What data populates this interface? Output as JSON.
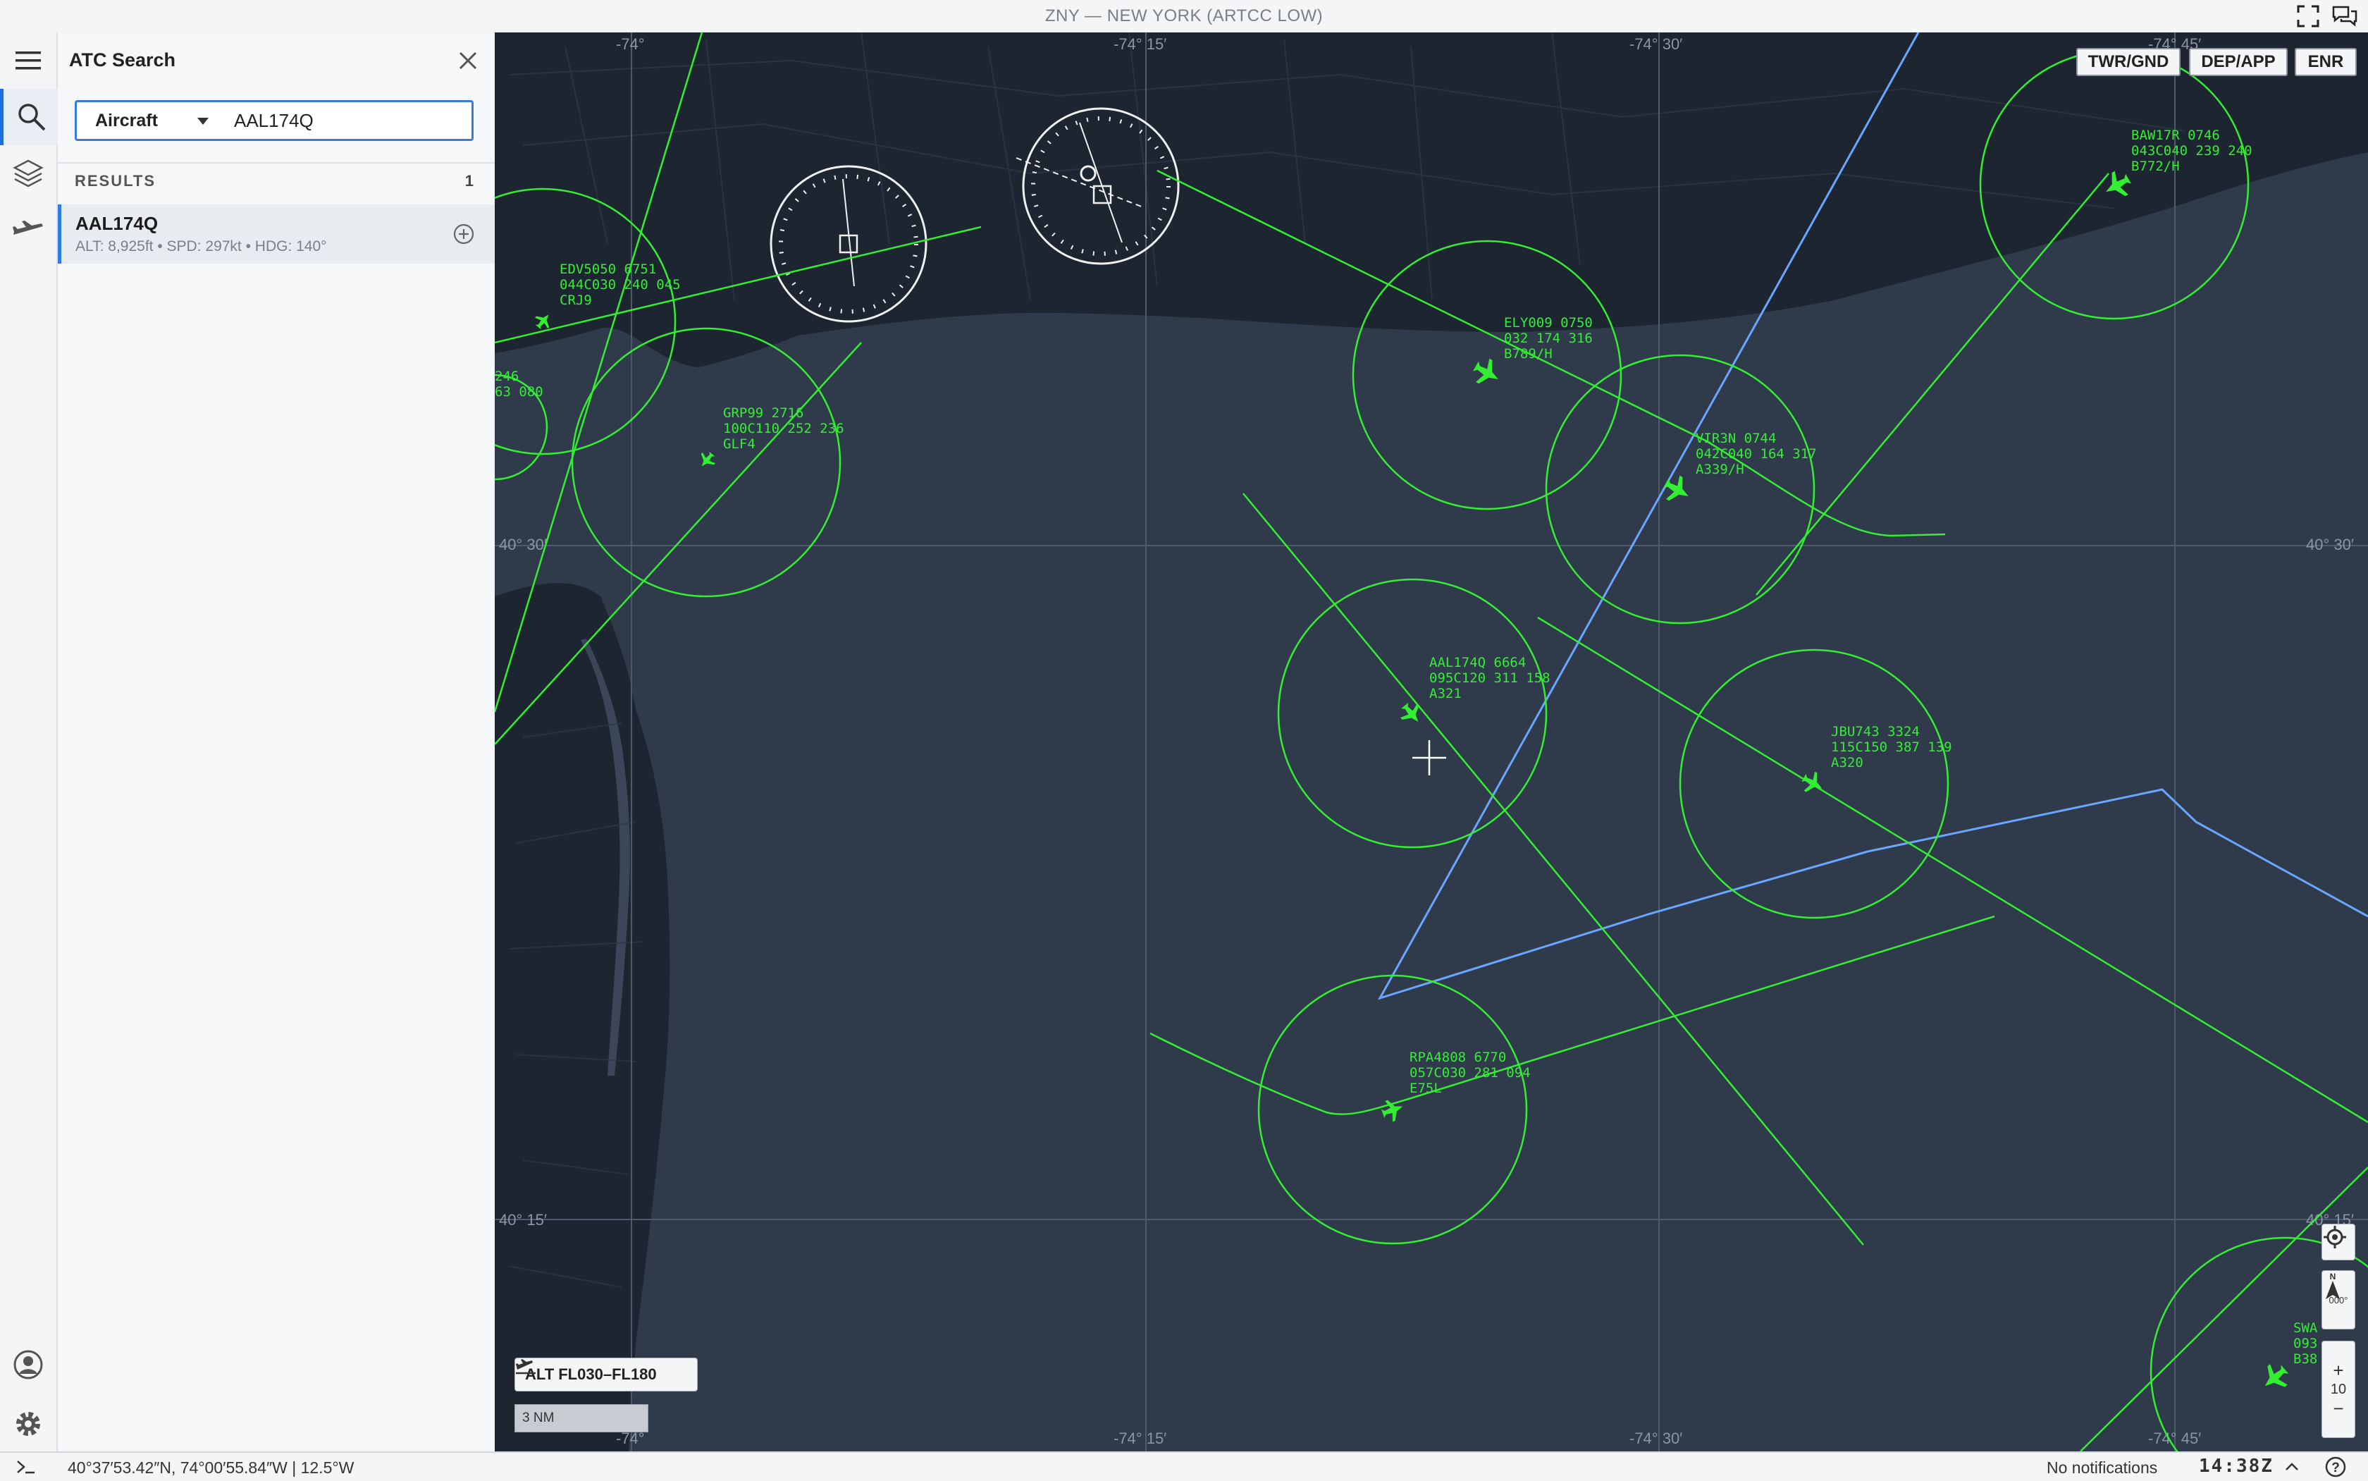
{
  "window": {
    "title": "ZNY — NEW YORK (ARTCC LOW)"
  },
  "panel": {
    "title": "ATC Search",
    "search": {
      "category": "Aircraft",
      "value": "AAL174Q",
      "placeholder": ""
    },
    "results_label": "RESULTS",
    "results_count": "1",
    "results": [
      {
        "callsign": "AAL174Q",
        "details": "ALT: 8,925ft • SPD: 297kt • HDG: 140°"
      }
    ]
  },
  "scope_buttons": {
    "twr_gnd": "TWR/GND",
    "dep_app": "DEP/APP",
    "enr": "ENR"
  },
  "map": {
    "grid_labels": {
      "top": [
        "-74°",
        "-74° 15′",
        "-74° 30′",
        "-74° 45′"
      ],
      "bottom": [
        "-74°",
        "-74° 15′",
        "-74° 30′",
        "-74° 45′"
      ],
      "left": [
        "40° 30′",
        "40° 15′"
      ],
      "right": [
        "40° 30′",
        "40° 15′"
      ]
    },
    "aircraft": [
      {
        "lines": [
          "EDV5050 6751",
          "044C030 240 045",
          "CRJ9"
        ]
      },
      {
        "lines": [
          "246",
          "63 080"
        ]
      },
      {
        "lines": [
          "GRP99 2716",
          "100C110 252 236",
          "GLF4"
        ]
      },
      {
        "lines": [
          "ELY009 0750",
          "032 174 316",
          "B789/H"
        ]
      },
      {
        "lines": [
          "VIR3N 0744",
          "042C040 164 317",
          "A339/H"
        ]
      },
      {
        "lines": [
          "BAW17R 0746",
          "043C040 239 240",
          "B772/H"
        ]
      },
      {
        "lines": [
          "AAL174Q 6664",
          "095C120 311 158",
          "A321"
        ]
      },
      {
        "lines": [
          "JBU743 3324",
          "115C150 387 139",
          "A320"
        ]
      },
      {
        "lines": [
          "RPA4808 6770",
          "057C030 281 094",
          "E75L"
        ]
      },
      {
        "lines": [
          "SWA",
          "093",
          "B38"
        ]
      }
    ],
    "alt_filter": "ALT FL030–FL180",
    "scale": "3 NM",
    "zoom_level": "10",
    "compass_heading": "000°"
  },
  "status": {
    "coords": "40°37′53.42″N, 74°00′55.84″W | 12.5°W",
    "notifications": "No notifications",
    "clock": "14:38Z"
  },
  "colors": {
    "accent": "#2d7be0",
    "target": "#33ee33",
    "route": "#6aa6ff",
    "land": "#1d2531",
    "water": "#2f3a4a"
  }
}
